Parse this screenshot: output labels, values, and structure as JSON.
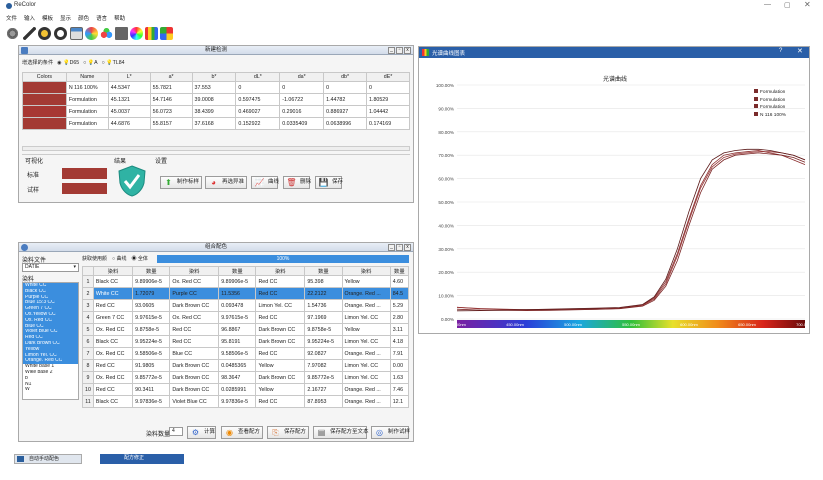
{
  "app": {
    "title": "ReColor",
    "menu": [
      "文件",
      "输入",
      "模板",
      "显示",
      "颜色",
      "语言",
      "帮助"
    ]
  },
  "new_match": {
    "title": "新建检测",
    "std_label": "增选择的条件",
    "illum": [
      "D65",
      "A",
      "TL84"
    ],
    "headers": [
      "Colors",
      "Name",
      "L*",
      "a*",
      "b*",
      "dL*",
      "da*",
      "db*",
      "dE*"
    ],
    "rows": [
      {
        "color": "#a33a34",
        "cells": [
          "N 116 100%",
          "44.5347",
          "55.7821",
          "37.553",
          "0",
          "0",
          "0",
          "0"
        ]
      },
      {
        "color": "#a33a34",
        "cells": [
          "Formulation",
          "45.1321",
          "54.7146",
          "39.0008",
          "0.597475",
          "-1.06722",
          "1.44782",
          "1.80529"
        ]
      },
      {
        "color": "#a73733",
        "cells": [
          "Formulation",
          "45.0037",
          "56.0723",
          "38.4399",
          "0.469027",
          "0.29016",
          "0.886927",
          "1.04442"
        ]
      },
      {
        "color": "#a33a34",
        "cells": [
          "Formulation",
          "44.6876",
          "55.8157",
          "37.6168",
          "0.152922",
          "0.0335409",
          "0.0638996",
          "0.174169"
        ]
      }
    ],
    "vis_label": "可视化",
    "std": "标准",
    "sample": "试样",
    "result_label": "结果",
    "settings_label": "设置",
    "buttons": [
      "制作标样",
      "再选异准",
      "曲线",
      "删除",
      "保存"
    ]
  },
  "spectral": {
    "title": "光谱曲线图表",
    "chart_title": "光谱曲线",
    "legend": [
      "Formulation",
      "Formulation",
      "Formulation",
      "N 116 100%"
    ]
  },
  "chart_data": {
    "type": "line",
    "title": "光谱曲线",
    "ylabel": "",
    "xlabel": "",
    "ylim": [
      0,
      100
    ],
    "y_ticks": [
      "0.00%",
      "10.00%",
      "20.00%",
      "30.00%",
      "40.00%",
      "50.00%",
      "60.00%",
      "70.00%",
      "80.00%",
      "90.00%",
      "100.00%"
    ],
    "x_ticks": [
      "400.00nm",
      "450.00nm",
      "500.00nm",
      "550.00nm",
      "600.00nm",
      "650.00nm",
      "700.00nm"
    ],
    "x": [
      400,
      420,
      440,
      460,
      480,
      500,
      520,
      540,
      560,
      570,
      580,
      590,
      600,
      610,
      620,
      630,
      640,
      650,
      660,
      670,
      680,
      690,
      700
    ],
    "series": [
      {
        "name": "Formulation",
        "values": [
          5,
          4.5,
          4.2,
          4.0,
          4.0,
          4.1,
          4.3,
          4.6,
          6,
          9,
          16,
          28,
          43,
          57,
          66,
          70,
          71,
          71.5,
          72,
          71,
          70,
          68,
          66
        ]
      },
      {
        "name": "Formulation",
        "values": [
          5,
          4.3,
          4.0,
          3.8,
          3.9,
          4.0,
          4.2,
          4.5,
          5.8,
          8.5,
          15,
          27,
          42,
          56,
          65,
          69,
          70.5,
          71,
          71.5,
          71.5,
          71,
          70,
          68
        ]
      },
      {
        "name": "Formulation",
        "values": [
          4.2,
          3.8,
          3.7,
          3.6,
          3.7,
          3.9,
          4.1,
          4.4,
          5.5,
          8,
          14,
          25,
          40,
          54,
          64,
          68,
          70,
          70.5,
          71,
          70.5,
          70,
          69,
          67
        ]
      },
      {
        "name": "N 116 100%",
        "values": [
          3.5,
          3.6,
          3.8,
          4.0,
          4.2,
          4.4,
          4.6,
          4.9,
          6.2,
          9.5,
          17,
          30,
          46,
          60,
          68,
          71,
          72,
          72.5,
          72.5,
          72,
          71,
          70,
          68
        ]
      }
    ]
  },
  "combo": {
    "title": "组合配色",
    "file_label": "染料文件",
    "file_value": "DATIE",
    "dye_label": "染料",
    "amount_label": "数量",
    "mode_label": "获取使用颜",
    "modes": [
      "曲线",
      "全体"
    ],
    "progress": "100%",
    "dye_list": [
      "White CC",
      "Black CC",
      "Purple CC",
      "Blue 15:3 CC",
      "Green 7 CC",
      "Ox.Yellow CC",
      "Ox. Red CC",
      "Blue CC",
      "Violet Blue CC",
      "Red CC",
      "Dark Brown CC",
      "Yellow",
      "Limon Yel. CC",
      "Orange. Red CC",
      "White base 1",
      "Wike base 2",
      "b",
      "N1",
      "W"
    ],
    "headers": [
      "染料",
      "数量",
      "染料",
      "数量",
      "染料",
      "数量",
      "染料",
      "数量"
    ],
    "rows": [
      [
        "Black CC",
        "9.89906e-5",
        "Ox. Red CC",
        "9.89906e-5",
        "Red CC",
        "95.398",
        "Yellow",
        "4.60"
      ],
      [
        "White CC",
        "1.72079",
        "Purple CC",
        "11.5356",
        "Red CC",
        "22.2122",
        "Orange. Red ...",
        "84.5"
      ],
      [
        "Red CC",
        "93.0605",
        "Dark Brown CC",
        "0.093478",
        "Limon Yel. CC",
        "1.54736",
        "Orange. Red ...",
        "5.29"
      ],
      [
        "Green 7 CC",
        "9.97615e-5",
        "Ox. Red CC",
        "9.97615e-5",
        "Red CC",
        "97.1969",
        "Limon Yel. CC",
        "2.80"
      ],
      [
        "Ox. Red CC",
        "9.8758e-5",
        "Red CC",
        "96.8867",
        "Dark Brown CC",
        "9.8758e-5",
        "Yellow",
        "3.11"
      ],
      [
        "Black CC",
        "9.95224e-5",
        "Red CC",
        "95.8191",
        "Dark Brown CC",
        "9.95224e-5",
        "Limon Yel. CC",
        "4.18"
      ],
      [
        "Ox. Red CC",
        "9.58506e-5",
        "Blue CC",
        "9.58506e-5",
        "Red CC",
        "92.0827",
        "Orange. Red ...",
        "7.91"
      ],
      [
        "Red CC",
        "91.9805",
        "Dark Brown CC",
        "0.0485365",
        "Yellow",
        "7.97082",
        "Limon Yel. CC",
        "0.00"
      ],
      [
        "Ox. Red CC",
        "9.85772e-5",
        "Dark Brown CC",
        "98.3647",
        "Dark Brown CC",
        "9.85772e-5",
        "Limon Yel. CC",
        "1.63"
      ],
      [
        "Red CC",
        "90.3411",
        "Dark Brown CC",
        "0.0285991",
        "Yellow",
        "2.16727",
        "Orange. Red ...",
        "7.46"
      ],
      [
        "Black CC",
        "9.97836e-5",
        "Violet Blue CC",
        "9.97836e-5",
        "Red CC",
        "87.8953",
        "Orange. Red ...",
        "12.1"
      ]
    ],
    "count_label": "染料数量",
    "count_value": "4",
    "buttons": [
      "计算",
      "查看配方",
      "保存配方",
      "保存配方至文本",
      "制作试样"
    ]
  },
  "taskbar": [
    "自动手动配色",
    "配方修正"
  ],
  "colors": {
    "accent": "#3b8ede",
    "swatch": "#a33a34",
    "shield": "#2fb3a4"
  }
}
